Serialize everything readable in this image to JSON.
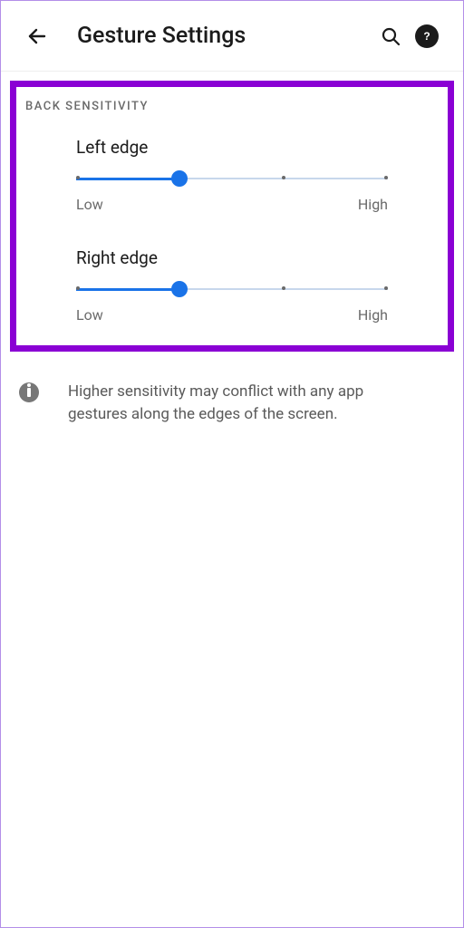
{
  "header": {
    "title": "Gesture Settings"
  },
  "section": {
    "label": "BACK SENSITIVITY"
  },
  "sliders": {
    "left": {
      "title": "Left edge",
      "low": "Low",
      "high": "High",
      "value_pct": 33
    },
    "right": {
      "title": "Right edge",
      "low": "Low",
      "high": "High",
      "value_pct": 33
    }
  },
  "note": {
    "text": "Higher sensitivity may conflict with any app gestures along the edges of the screen."
  }
}
